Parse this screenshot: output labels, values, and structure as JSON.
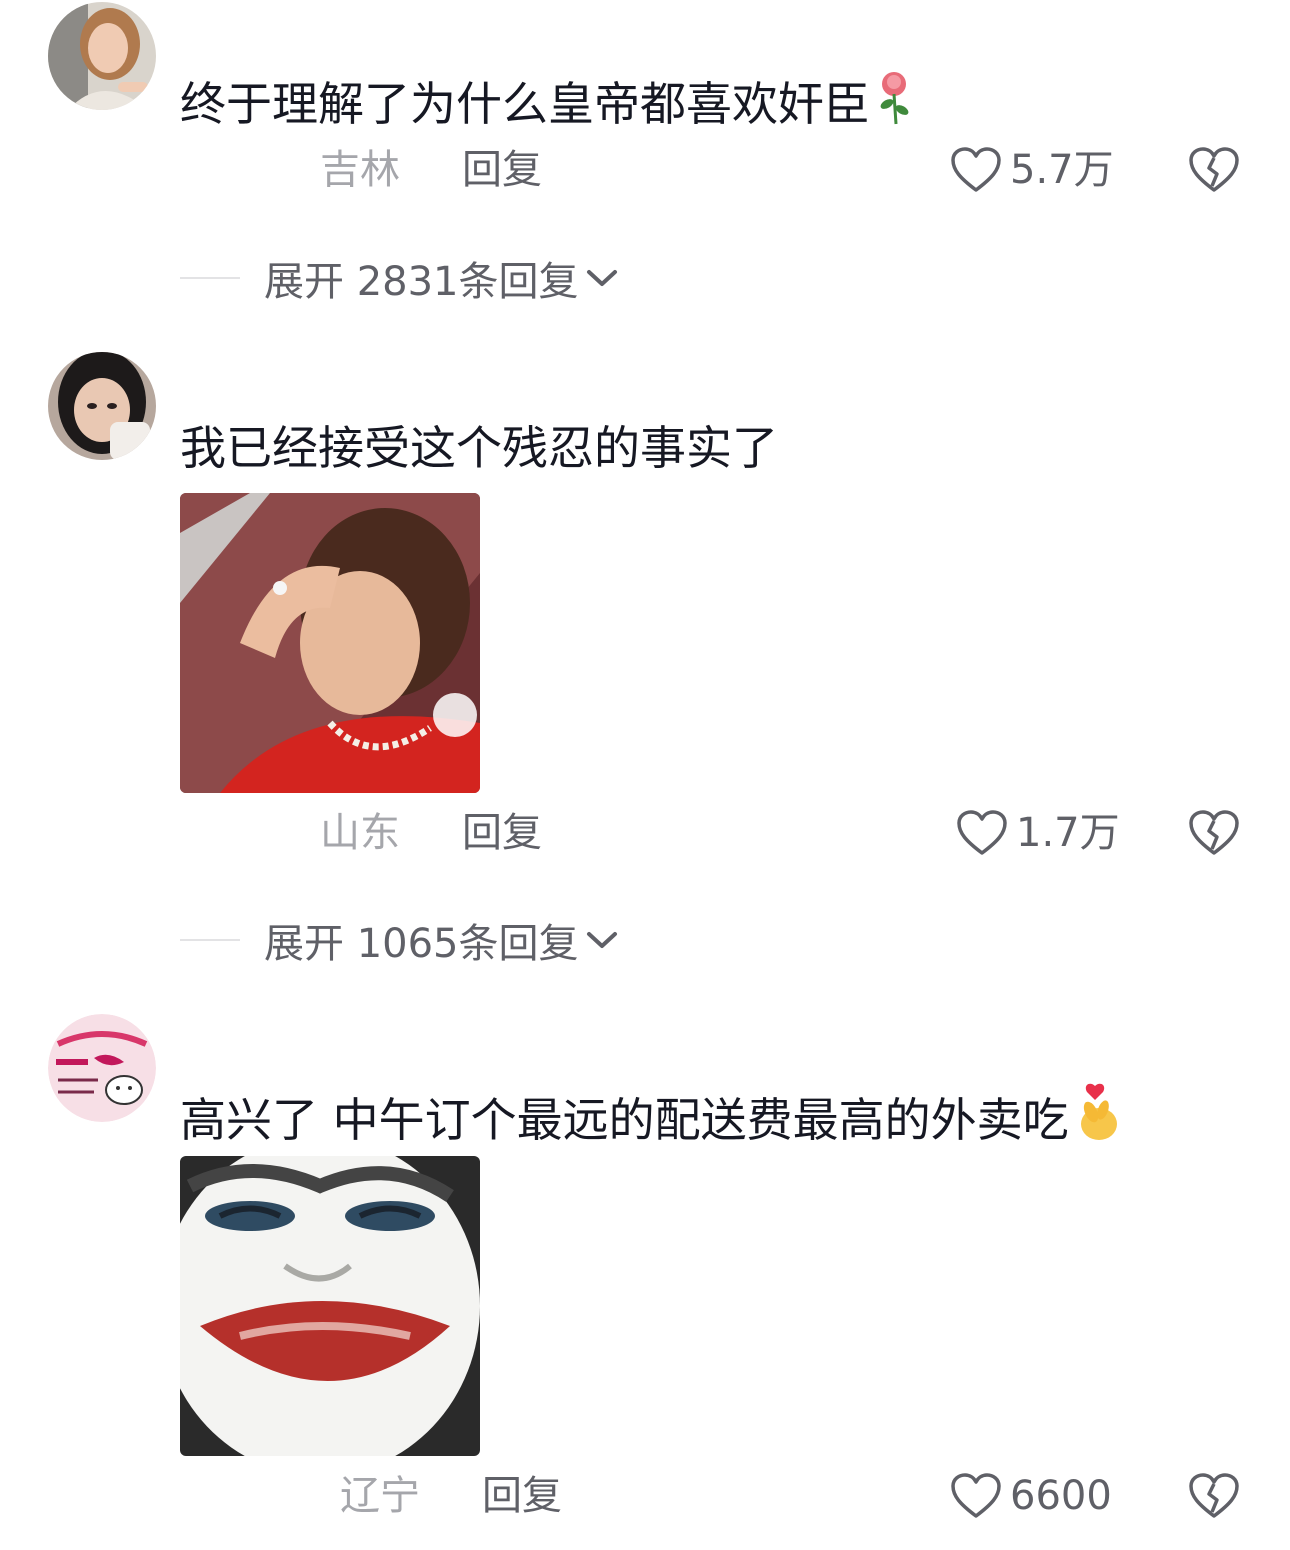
{
  "comments": [
    {
      "text": "终于理解了为什么皇帝都喜欢奸臣",
      "emoji": "rose-icon",
      "location": "吉林",
      "reply_label": "回复",
      "like_count": "5.7万",
      "expand_label": "展开 2831条回复"
    },
    {
      "text": "我已经接受这个残忍的事实了",
      "location": "山东",
      "reply_label": "回复",
      "like_count": "1.7万",
      "expand_label": "展开 1065条回复"
    },
    {
      "text": "高兴了 中午订个最远的配送费最高的外卖吃",
      "emoji": "finger-heart-icon",
      "location": "辽宁",
      "reply_label": "回复",
      "like_count": "6600"
    }
  ],
  "colors": {
    "text_primary": "#161823",
    "text_secondary": "#5f6067",
    "text_muted": "#a5a6ab",
    "divider": "#e3e3e5"
  }
}
